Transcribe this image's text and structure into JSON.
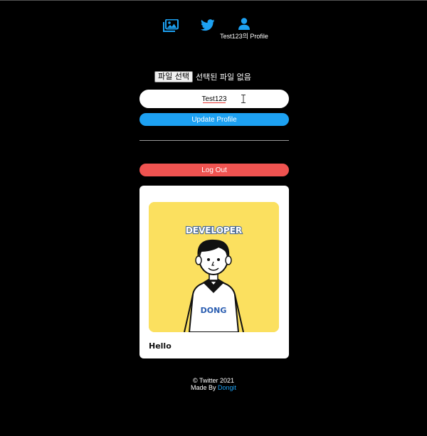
{
  "nav": {
    "home_icon": "images-icon",
    "twitter_icon": "twitter-bird-icon",
    "profile_icon": "user-icon",
    "profile_label": "Test123의 Profile",
    "accent_color": "#1da1f2"
  },
  "profile_form": {
    "file_button_label": "파일 선택",
    "file_status": "선택된 파일 없음",
    "name_value": "Test123",
    "update_button_label": "Update Profile"
  },
  "logout_button_label": "Log Out",
  "tweet": {
    "image_text_top": "DEVELOPER",
    "image_text_shirt": "DONG",
    "text": "Hello"
  },
  "footer": {
    "copyright": "© Twitter 2021",
    "made_by_prefix": "Made By",
    "author": "Dongit"
  },
  "colors": {
    "background": "#000000",
    "primary": "#1da1f2",
    "danger": "#ef5350",
    "image_bg": "#fbe05f"
  }
}
